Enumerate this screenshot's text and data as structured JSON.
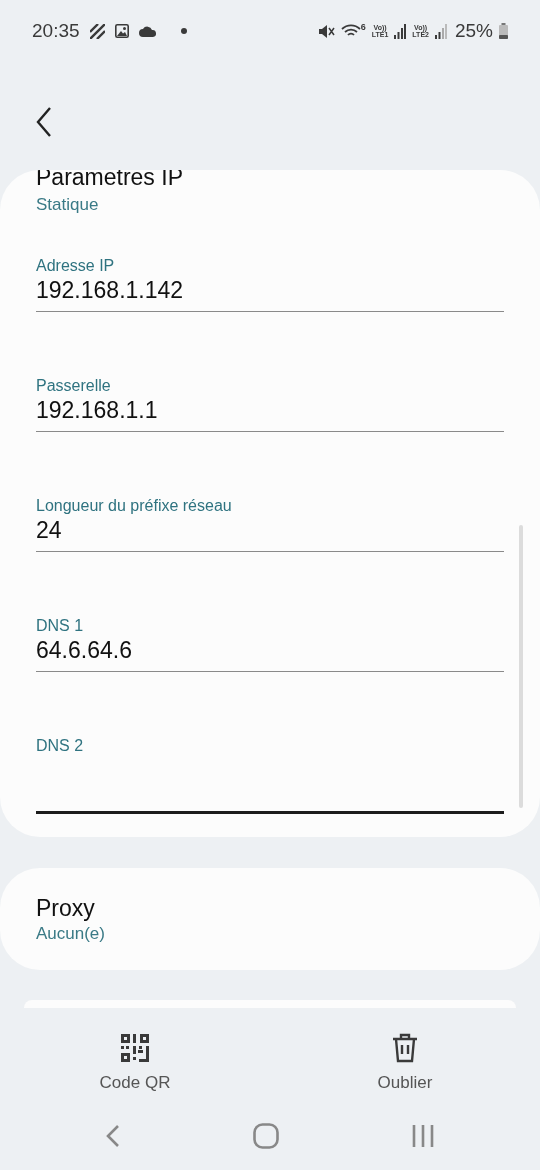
{
  "status_bar": {
    "time": "20:35",
    "volte_1": "Vo))",
    "lte_1": "LTE1",
    "volte_2": "Vo))",
    "lte_2": "LTE2",
    "wifi_badge": "6",
    "battery": "25%"
  },
  "ip_settings": {
    "title": "Parametres IP",
    "value": "Statique",
    "fields": [
      {
        "label": "Adresse IP",
        "value": "192.168.1.142",
        "focused": false
      },
      {
        "label": "Passerelle",
        "value": "192.168.1.1",
        "focused": false
      },
      {
        "label": "Longueur du préfixe réseau",
        "value": "24",
        "focused": false
      },
      {
        "label": "DNS 1",
        "value": "64.6.64.6",
        "focused": false
      },
      {
        "label": "DNS 2",
        "focused": true
      }
    ]
  },
  "proxy": {
    "title": "Proxy",
    "value": "Aucun(e)"
  },
  "actions": [
    {
      "kind": "qr",
      "label": "Code QR"
    },
    {
      "kind": "delete",
      "label": "Oublier"
    }
  ]
}
